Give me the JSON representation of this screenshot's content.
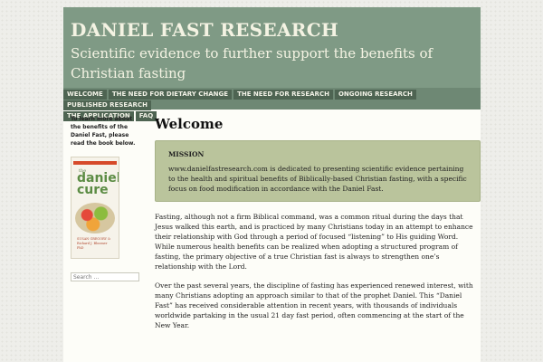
{
  "site": {
    "title": "DANIEL FAST RESEARCH",
    "description": "Scientific evidence to further support the benefits of Christian fasting"
  },
  "nav": {
    "row1": [
      "WELCOME",
      "THE NEED FOR DIETARY CHANGE",
      "THE NEED FOR RESEARCH",
      "ONGOING RESEARCH",
      "PUBLISHED RESEARCH"
    ],
    "row2": [
      "THE APPLICATION",
      "FAQ"
    ]
  },
  "sidebar": {
    "promo": "To learn more about the benefits of the Daniel Fast, please read the book below.",
    "book": {
      "top_line": "The Breakthrough Plan to Ultimate Health",
      "the": "the",
      "title_1": "daniel",
      "title_2": "cure",
      "authors": "SUSAN GREGORY & Richard J. Bloomer PhD"
    },
    "search_placeholder": "Search ..."
  },
  "main": {
    "title": "Welcome",
    "mission_title": "MISSION",
    "mission_body": "www.danielfastresearch.com is dedicated to presenting scientific evidence pertaining to the health and spiritual benefits of Biblically-based Christian fasting, with a specific focus on food modification in accordance with the Daniel Fast.",
    "para1": "Fasting, although not a firm Biblical command, was a common ritual during the days that Jesus walked this earth, and is practiced by many Christians today in an attempt to enhance their relationship with God through a period of focused “listening” to His guiding Word. While numerous health benefits can be realized when adopting a structured program of fasting, the primary objective of a true Christian fast is always to strengthen one’s relationship with the Lord.",
    "para2": "Over the past several years, the discipline of fasting has experienced renewed interest, with many Christians adopting an approach similar to that of the prophet Daniel. This “Daniel Fast” has received considerable attention in recent years, with thousands of individuals worldwide partaking in the usual 21 day fast period, often commencing at the start of the New Year."
  },
  "colors": {
    "header_bg": "#7f9a85",
    "nav_item_bg": "#4e6452",
    "mission_bg": "#bac49c"
  }
}
